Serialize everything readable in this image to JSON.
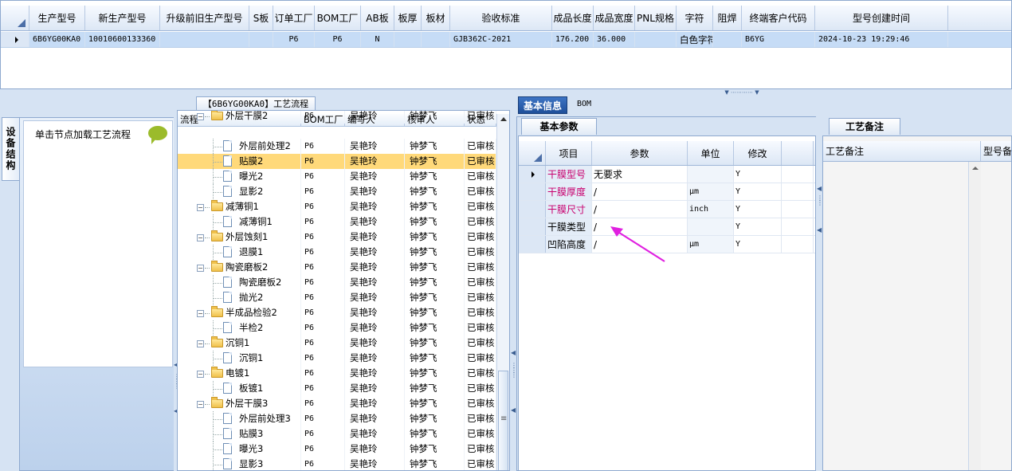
{
  "top_grid": {
    "columns": [
      "生产型号",
      "新生产型号",
      "升级前旧生产型号",
      "S板",
      "订单工厂",
      "BOM工厂",
      "AB板",
      "板厚",
      "板材",
      "验收标准",
      "成品长度",
      "成品宽度",
      "PNL规格",
      "字符",
      "阻焊",
      "终端客户代码",
      "型号创建时间"
    ],
    "row": [
      "6B6YG00KA0",
      "10010600133360",
      "",
      "",
      "P6",
      "P6",
      "N",
      "",
      "",
      "GJB362C-2021",
      "176.200",
      "36.000",
      "",
      "白色字符",
      "",
      "B6YG",
      "2024-10-23 19:29:46"
    ]
  },
  "left_panel": {
    "vertical_tab": "设备结构",
    "hint": "单击节点加载工艺流程"
  },
  "tree": {
    "tab_title": "【6B6YG00KA0】工艺流程",
    "columns": [
      "流程",
      "BOM工厂",
      "编写人",
      "核审人",
      "状态"
    ],
    "rows": [
      {
        "level": 0,
        "expand": "−",
        "label": "外层干膜2",
        "bom": "P6",
        "author": "吴艳玲",
        "reviewer": "钟梦飞",
        "status": "已审核",
        "partial": true
      },
      {
        "level": 1,
        "label": "外层前处理2",
        "bom": "P6",
        "author": "吴艳玲",
        "reviewer": "钟梦飞",
        "status": "已审核"
      },
      {
        "level": 1,
        "label": "贴膜2",
        "bom": "P6",
        "author": "吴艳玲",
        "reviewer": "钟梦飞",
        "status": "已审核",
        "selected": true
      },
      {
        "level": 1,
        "label": "曝光2",
        "bom": "P6",
        "author": "吴艳玲",
        "reviewer": "钟梦飞",
        "status": "已审核"
      },
      {
        "level": 1,
        "label": "显影2",
        "bom": "P6",
        "author": "吴艳玲",
        "reviewer": "钟梦飞",
        "status": "已审核"
      },
      {
        "level": 0,
        "expand": "−",
        "label": "减薄铜1",
        "bom": "P6",
        "author": "吴艳玲",
        "reviewer": "钟梦飞",
        "status": "已审核"
      },
      {
        "level": 1,
        "label": "减薄铜1",
        "bom": "P6",
        "author": "吴艳玲",
        "reviewer": "钟梦飞",
        "status": "已审核"
      },
      {
        "level": 0,
        "expand": "−",
        "label": "外层蚀刻1",
        "bom": "P6",
        "author": "吴艳玲",
        "reviewer": "钟梦飞",
        "status": "已审核"
      },
      {
        "level": 1,
        "label": "退膜1",
        "bom": "P6",
        "author": "吴艳玲",
        "reviewer": "钟梦飞",
        "status": "已审核"
      },
      {
        "level": 0,
        "expand": "−",
        "label": "陶瓷磨板2",
        "bom": "P6",
        "author": "吴艳玲",
        "reviewer": "钟梦飞",
        "status": "已审核"
      },
      {
        "level": 1,
        "label": "陶瓷磨板2",
        "bom": "P6",
        "author": "吴艳玲",
        "reviewer": "钟梦飞",
        "status": "已审核"
      },
      {
        "level": 1,
        "label": "抛光2",
        "bom": "P6",
        "author": "吴艳玲",
        "reviewer": "钟梦飞",
        "status": "已审核"
      },
      {
        "level": 0,
        "expand": "−",
        "label": "半成品检验2",
        "bom": "P6",
        "author": "吴艳玲",
        "reviewer": "钟梦飞",
        "status": "已审核"
      },
      {
        "level": 1,
        "label": "半检2",
        "bom": "P6",
        "author": "吴艳玲",
        "reviewer": "钟梦飞",
        "status": "已审核"
      },
      {
        "level": 0,
        "expand": "−",
        "label": "沉铜1",
        "bom": "P6",
        "author": "吴艳玲",
        "reviewer": "钟梦飞",
        "status": "已审核"
      },
      {
        "level": 1,
        "label": "沉铜1",
        "bom": "P6",
        "author": "吴艳玲",
        "reviewer": "钟梦飞",
        "status": "已审核"
      },
      {
        "level": 0,
        "expand": "−",
        "label": "电镀1",
        "bom": "P6",
        "author": "吴艳玲",
        "reviewer": "钟梦飞",
        "status": "已审核"
      },
      {
        "level": 1,
        "label": "板镀1",
        "bom": "P6",
        "author": "吴艳玲",
        "reviewer": "钟梦飞",
        "status": "已审核"
      },
      {
        "level": 0,
        "expand": "−",
        "label": "外层干膜3",
        "bom": "P6",
        "author": "吴艳玲",
        "reviewer": "钟梦飞",
        "status": "已审核"
      },
      {
        "level": 1,
        "label": "外层前处理3",
        "bom": "P6",
        "author": "吴艳玲",
        "reviewer": "钟梦飞",
        "status": "已审核"
      },
      {
        "level": 1,
        "label": "贴膜3",
        "bom": "P6",
        "author": "吴艳玲",
        "reviewer": "钟梦飞",
        "status": "已审核"
      },
      {
        "level": 1,
        "label": "曝光3",
        "bom": "P6",
        "author": "吴艳玲",
        "reviewer": "钟梦飞",
        "status": "已审核"
      },
      {
        "level": 1,
        "label": "显影3",
        "bom": "P6",
        "author": "吴艳玲",
        "reviewer": "钟梦飞",
        "status": "已审核"
      }
    ]
  },
  "right": {
    "tabs": [
      "基本信息",
      "BOM"
    ],
    "basic_subtab": "基本参数",
    "param_columns": [
      "项目",
      "参数",
      "单位",
      "修改"
    ],
    "params": [
      {
        "item": "干膜型号",
        "value": "无要求",
        "unit": "",
        "edit": "Y",
        "pink": true,
        "current": true
      },
      {
        "item": "干膜厚度",
        "value": "/",
        "unit": "μm",
        "edit": "Y",
        "pink": true
      },
      {
        "item": "干膜尺寸",
        "value": "/",
        "unit": "inch",
        "edit": "Y",
        "pink": true
      },
      {
        "item": "干膜类型",
        "value": "/",
        "unit": "",
        "edit": "Y",
        "pink": false
      },
      {
        "item": "凹陷高度",
        "value": "/",
        "unit": "μm",
        "edit": "Y",
        "pink": false
      }
    ],
    "note_subtab": "工艺备注",
    "note_columns": [
      "工艺备注",
      "型号备"
    ]
  },
  "colors": {
    "annotation_arrow": "#e020e0",
    "accent_tab": "#1f4f9a",
    "selected_row": "#ffd97a",
    "pink_text": "#c8006e"
  }
}
